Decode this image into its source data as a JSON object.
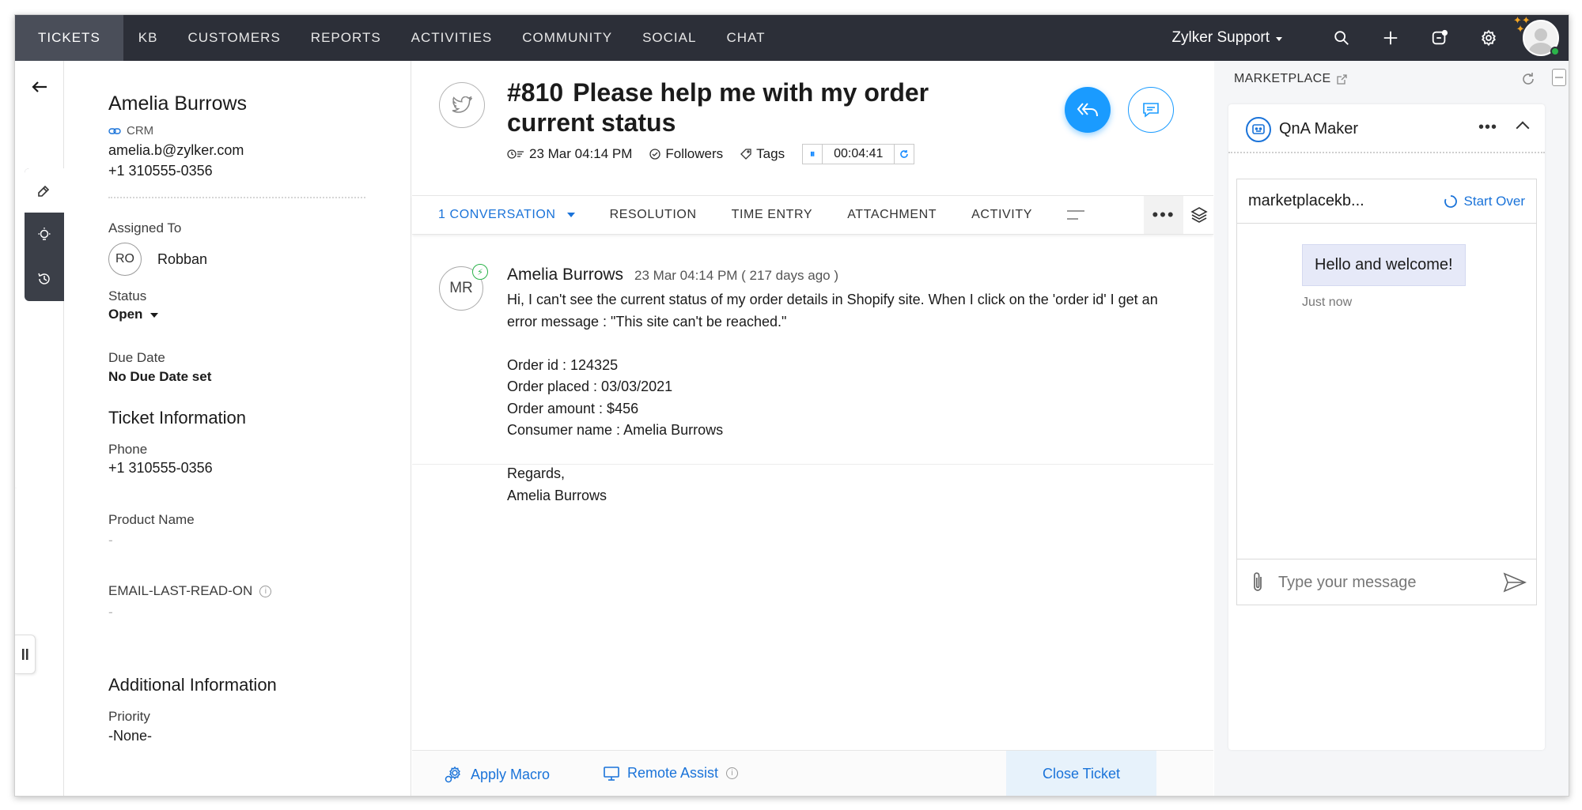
{
  "topnav": {
    "tabs": [
      "TICKETS",
      "KB",
      "CUSTOMERS",
      "REPORTS",
      "ACTIVITIES",
      "COMMUNITY",
      "SOCIAL",
      "CHAT"
    ],
    "active_tab": "TICKETS",
    "org_name": "Zylker Support",
    "icons": [
      "search-icon",
      "plus-icon",
      "notification-icon",
      "gear-icon"
    ],
    "colors": {
      "bar": "#2c2f38",
      "active_tab": "#4a4e59"
    }
  },
  "contact": {
    "name": "Amelia Burrows",
    "crm_label": "CRM",
    "email": "amelia.b@zylker.com",
    "phone": "+1 310555-0356"
  },
  "properties": {
    "assigned_to_label": "Assigned To",
    "agent_initials": "RO",
    "agent_name": "Robban",
    "status_label": "Status",
    "status_value": "Open",
    "due_date_label": "Due Date",
    "due_date_value": "No Due Date set",
    "ticket_info_heading": "Ticket Information",
    "phone_label": "Phone",
    "phone_value": "+1 310555-0356",
    "product_label": "Product Name",
    "product_value": "-",
    "email_read_label": "EMAIL-LAST-READ-ON",
    "email_read_value": "-",
    "additional_heading": "Additional Information",
    "priority_label": "Priority",
    "priority_value": "-None-"
  },
  "ticket": {
    "number": "#810",
    "subject": "Please help me with my order current status",
    "created": "23 Mar 04:14 PM",
    "followers_label": "Followers",
    "tags_label": "Tags",
    "timer": "00:04:41",
    "accent": "#1a9bff"
  },
  "subtabs": {
    "conversation": "1 CONVERSATION",
    "items": [
      "RESOLUTION",
      "TIME ENTRY",
      "ATTACHMENT",
      "ACTIVITY"
    ]
  },
  "thread": {
    "avatar_initials": "MR",
    "author": "Amelia Burrows",
    "time": "23 Mar 04:14 PM ( 217 days ago )",
    "body": [
      "Hi, I can't see the current status of my order details in Shopify site. When I click on the 'order id' I get an error message : \"This site can't be reached.\"",
      "",
      "Order id : 124325",
      "Order placed : 03/03/2021",
      "Order amount : $456",
      "Consumer name : Amelia Burrows",
      "",
      "Regards,",
      "Amelia Burrows"
    ]
  },
  "bottom_bar": {
    "apply_macro": "Apply Macro",
    "remote_assist": "Remote Assist",
    "close_ticket": "Close Ticket"
  },
  "marketplace": {
    "heading": "MARKETPLACE",
    "widget_title": "QnA Maker",
    "kb_name": "marketplacekb...",
    "start_over": "Start Over",
    "bot_message": "Hello and welcome!",
    "bot_message_time": "Just now",
    "input_placeholder": "Type your message"
  }
}
